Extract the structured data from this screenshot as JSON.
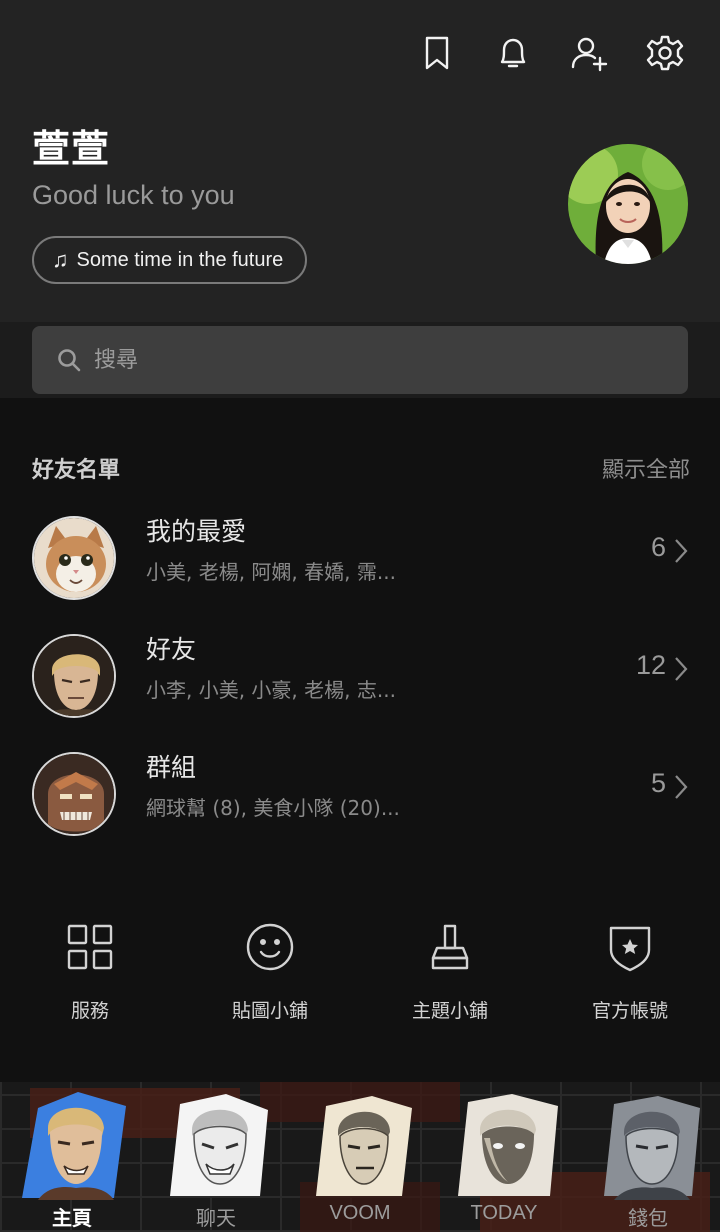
{
  "header": {
    "icons": [
      "bookmark-icon",
      "bell-icon",
      "add-friend-icon",
      "gear-icon"
    ]
  },
  "profile": {
    "name": "萱萱",
    "status_message": "Good luck to you",
    "music": "Some time in the future"
  },
  "search": {
    "placeholder": "搜尋"
  },
  "friends": {
    "section_title": "好友名單",
    "show_all": "顯示全部",
    "rows": [
      {
        "title": "我的最愛",
        "subtitle": "小美, 老楊, 阿嫻, 春嬌, 霈...",
        "count": "6"
      },
      {
        "title": "好友",
        "subtitle": "小李, 小美, 小豪, 老楊, 志...",
        "count": "12"
      },
      {
        "title": "群組",
        "subtitle": "網球幫 (8), 美食小隊 (20)...",
        "count": "5"
      }
    ]
  },
  "services": [
    {
      "label": "服務",
      "icon": "grid-icon"
    },
    {
      "label": "貼圖小鋪",
      "icon": "smiley-icon"
    },
    {
      "label": "主題小鋪",
      "icon": "brush-icon"
    },
    {
      "label": "官方帳號",
      "icon": "shield-star-icon"
    }
  ],
  "nav": {
    "tabs": [
      {
        "label": "主頁",
        "active": true
      },
      {
        "label": "聊天",
        "active": false
      },
      {
        "label": "VOOM",
        "active": false
      },
      {
        "label": "TODAY",
        "active": false
      },
      {
        "label": "錢包",
        "active": false
      }
    ]
  },
  "colors": {
    "background": "#111111",
    "header_bg": "#232323",
    "search_bg": "#3e3e3e",
    "accent_blue": "#3b7fe0"
  }
}
